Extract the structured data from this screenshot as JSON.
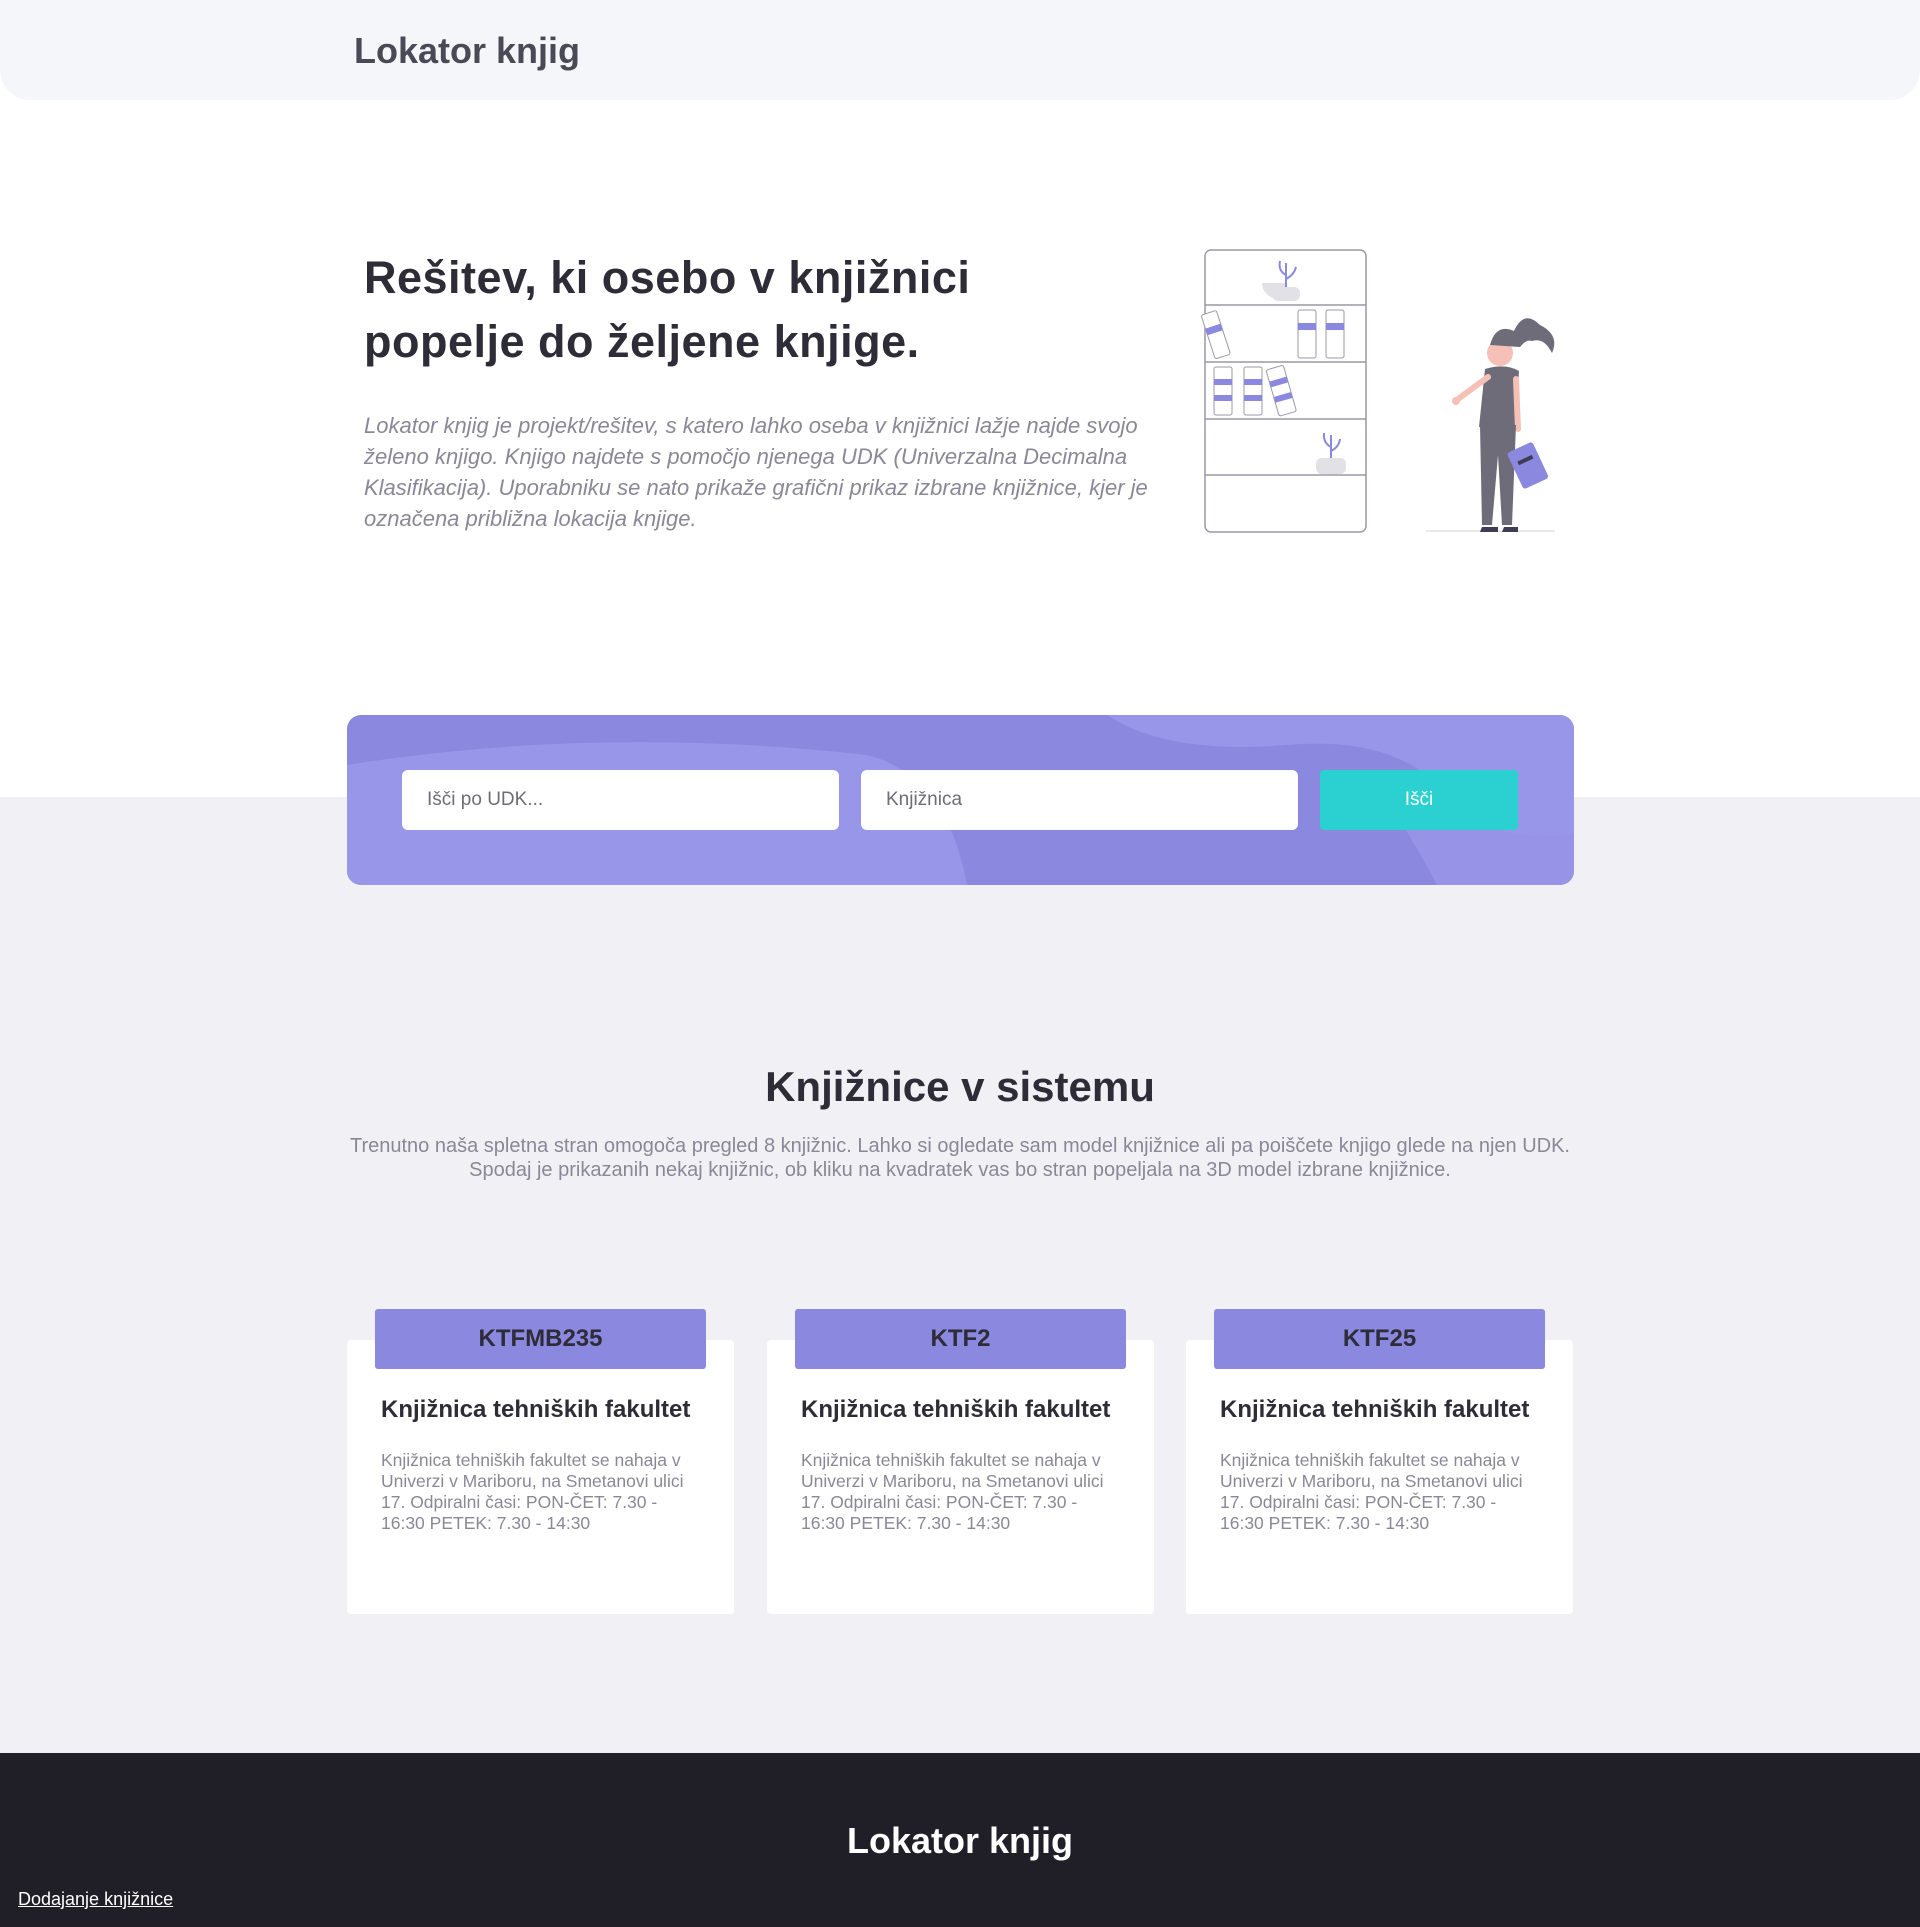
{
  "header": {
    "logo": "Lokator knjig"
  },
  "hero": {
    "title": "Rešitev, ki osebo v knjižnici popelje do željene knjige.",
    "description": "Lokator knjig je projekt/rešitev, s katero lahko oseba v knjižnici lažje najde svojo želeno knjigo. Knjigo najdete s pomočjo njenega UDK (Univerzalna Decimalna Klasifikacija). Uporabniku se nato prikaže grafični prikaz izbrane knjižnice, kjer je označena približna lokacija knjige."
  },
  "search": {
    "udk_placeholder": "Išči po UDK...",
    "library_placeholder": "Knjižnica",
    "button_label": "Išči"
  },
  "libraries_section": {
    "title": "Knjižnice v sistemu",
    "description": "Trenutno naša spletna stran omogoča pregled 8 knjižnic. Lahko si ogledate sam model knjižnice ali pa poiščete knjigo glede na njen UDK. Spodaj je prikazanih nekaj knjižnic, ob kliku na kvadratek vas bo stran popeljala na 3D model izbrane knjižnice.",
    "cards": [
      {
        "code": "KTFMB235",
        "title": "Knjižnica tehniških fakultet",
        "text": "Knjižnica tehniških fakultet se nahaja v Univerzi v Mariboru, na Smetanovi ulici 17. Odpiralni časi: PON-ČET: 7.30 - 16:30 PETEK: 7.30 - 14:30"
      },
      {
        "code": "KTF2",
        "title": "Knjižnica tehniških fakultet",
        "text": "Knjižnica tehniških fakultet se nahaja v Univerzi v Mariboru, na Smetanovi ulici 17. Odpiralni časi: PON-ČET: 7.30 - 16:30 PETEK: 7.30 - 14:30"
      },
      {
        "code": "KTF25",
        "title": "Knjižnica tehniških fakultet",
        "text": "Knjižnica tehniških fakultet se nahaja v Univerzi v Mariboru, na Smetanovi ulici 17. Odpiralni časi: PON-ČET: 7.30 - 16:30 PETEK: 7.30 - 14:30"
      }
    ]
  },
  "footer": {
    "logo": "Lokator knjig",
    "add_library_link": "Dodajanje knjižnice"
  },
  "colors": {
    "accent": "#8b88e0",
    "button": "#2ad1d0",
    "footer_bg": "#201e27",
    "band_bg": "#f0f0f5"
  },
  "icons": {
    "hero_illustration": "woman-with-bookshelf-illustration"
  }
}
